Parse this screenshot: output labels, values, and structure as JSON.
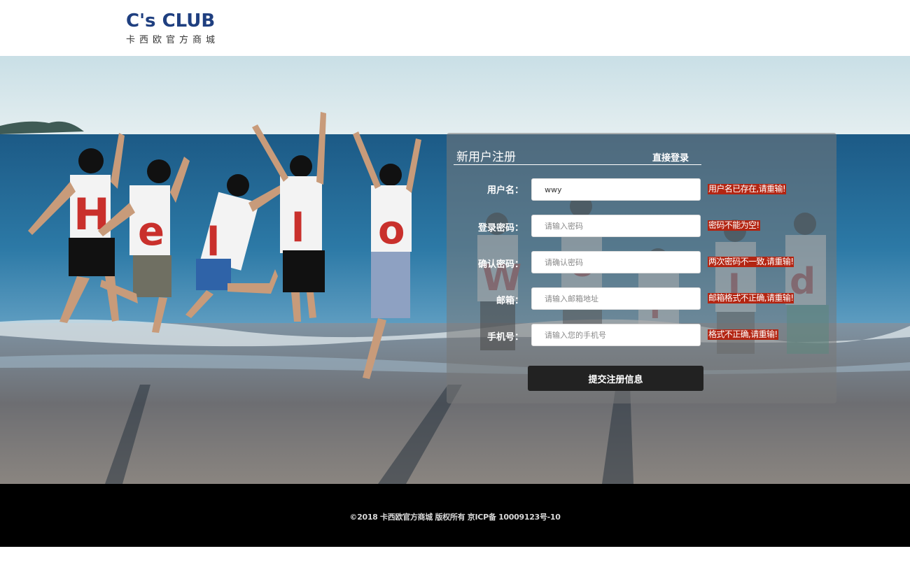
{
  "header": {
    "logo_main": "C's CLUB",
    "logo_sub": "卡西欧官方商城"
  },
  "register": {
    "title": "新用户注册",
    "login_link": "直接登录",
    "fields": [
      {
        "label": "用户名：",
        "value": "wwy",
        "placeholder": "",
        "error": "用户名已存在,请重输!"
      },
      {
        "label": "登录密码：",
        "value": "",
        "placeholder": "请输入密码",
        "error": "密码不能为空!"
      },
      {
        "label": "确认密码：",
        "value": "",
        "placeholder": "请确认密码",
        "error": "两次密码不一致,请重输!"
      },
      {
        "label": "邮箱：",
        "value": "",
        "placeholder": "请输入邮箱地址",
        "error": "邮箱格式不正确,请重输!"
      },
      {
        "label": "手机号：",
        "value": "",
        "placeholder": "请输入您的手机号",
        "error": "格式不正确,请重输!"
      }
    ],
    "submit_label": "提交注册信息"
  },
  "hero": {
    "shirt_letters": [
      "H",
      "e",
      "l",
      "l",
      "o",
      "W",
      "o",
      "r",
      "l",
      "d"
    ]
  },
  "footer": {
    "copyright": "©2018 卡西欧官方商城 版权所有 京ICP备 10009123号-10"
  },
  "colors": {
    "brand": "#1f3f80",
    "error_bg": "#b32512",
    "button_bg": "#222222",
    "footer_bg": "#000000"
  }
}
